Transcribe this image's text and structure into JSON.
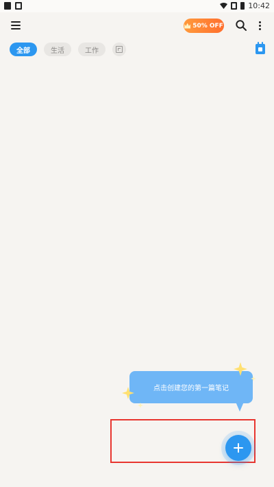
{
  "status_bar": {
    "time": "10:42"
  },
  "top_bar": {
    "promo_label": "50% OFF"
  },
  "tabs": [
    {
      "label": "全部",
      "active": true
    },
    {
      "label": "生活",
      "active": false
    },
    {
      "label": "工作",
      "active": false
    }
  ],
  "tooltip": {
    "text": "点击创建您的第一篇笔记"
  },
  "colors": {
    "accent": "#2c97f0",
    "promo": "#ff7a30",
    "bubble": "#6fb6f6",
    "highlight": "#e8352f"
  }
}
